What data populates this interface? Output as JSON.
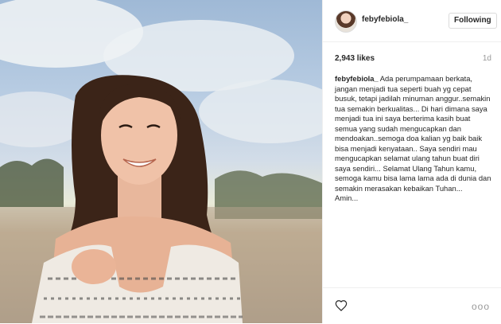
{
  "post": {
    "username": "febyfebiola_",
    "follow_label": "Following",
    "likes": "2,943 likes",
    "time_ago": "1d",
    "caption_user": "febyfebiola_",
    "caption_text": "Ada perumpamaan berkata, jangan menjadi tua seperti buah yg cepat busuk, tetapi jadilah minuman anggur..semakin tua semakin berkualitas... Di hari dimana saya menjadi tua ini saya berterima kasih buat semua yang sudah mengucapkan dan mendoakan..semoga doa kalian yg baik baik bisa menjadi kenyataan.. Saya sendiri mau mengucapkan selamat ulang tahun buat diri saya sendiri... Selamat Ulang Tahun kamu, semoga kamu bisa lama lama ada di dunia dan semakin merasakan kebaikan Tuhan...\nAmin..."
  },
  "icons": {
    "like": "heart-outline-icon",
    "more": "more-options-icon",
    "more_glyph": "ooo"
  },
  "colors": {
    "border": "#efefef",
    "text": "#262626",
    "muted": "#999999"
  }
}
